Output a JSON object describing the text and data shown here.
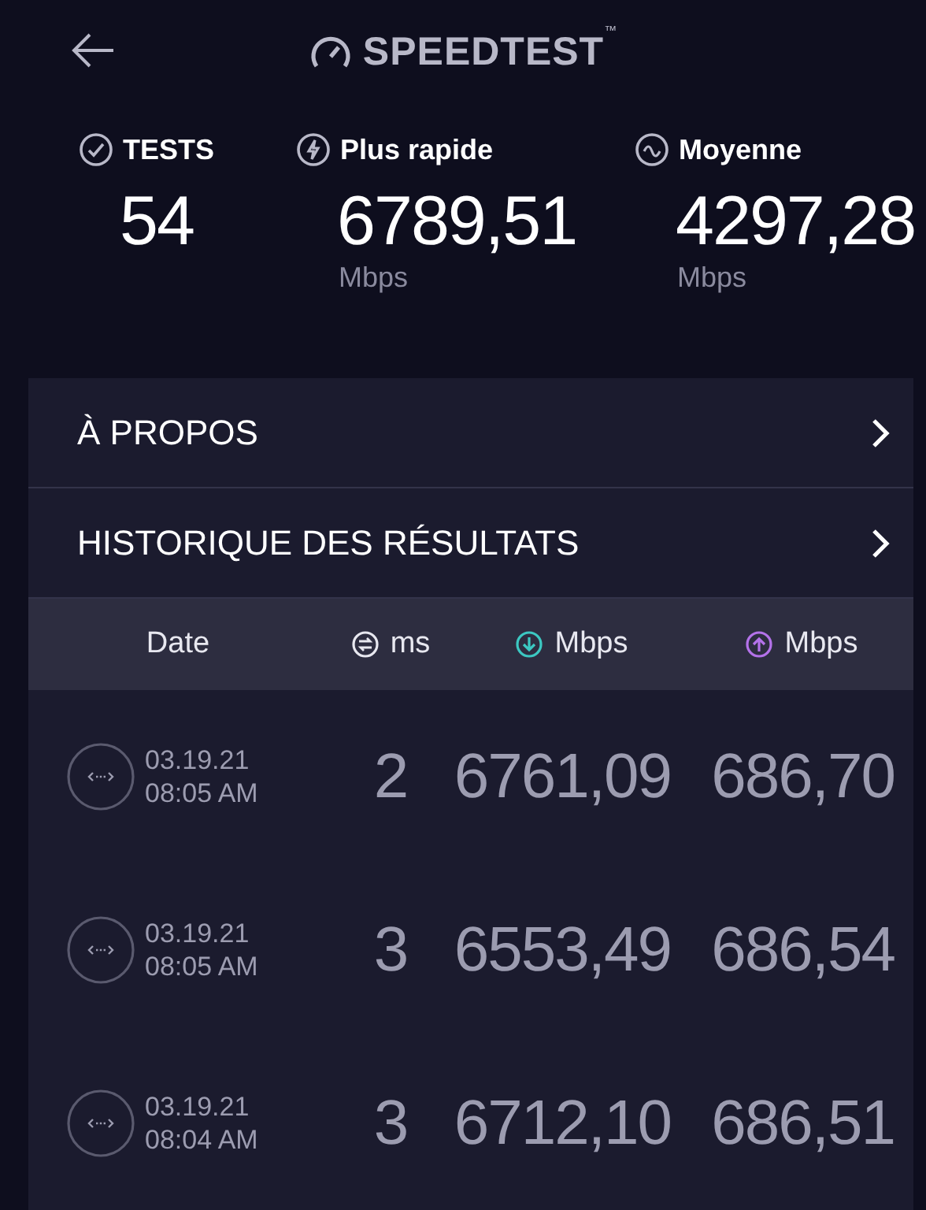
{
  "header": {
    "logo": "SPEEDTEST",
    "trademark": "™"
  },
  "stats": [
    {
      "kind": "tests",
      "label": "TESTS",
      "value": "54"
    },
    {
      "kind": "fastest",
      "label": "Plus rapide",
      "value": "6789,51",
      "unit": "Mbps"
    },
    {
      "kind": "average",
      "label": "Moyenne",
      "value": "4297,28",
      "unit": "Mbps"
    }
  ],
  "menu": [
    {
      "label": "À PROPOS"
    },
    {
      "label": "HISTORIQUE DES RÉSULTATS"
    }
  ],
  "table": {
    "columns": [
      {
        "kind": "date",
        "label": "Date"
      },
      {
        "kind": "ping",
        "label": "ms"
      },
      {
        "kind": "download",
        "label": "Mbps"
      },
      {
        "kind": "upload",
        "label": "Mbps"
      }
    ],
    "rows": [
      {
        "date": "03.19.21",
        "time": "08:05 AM",
        "ping": "2",
        "download": "6761,09",
        "upload": "686,70"
      },
      {
        "date": "03.19.21",
        "time": "08:05 AM",
        "ping": "3",
        "download": "6553,49",
        "upload": "686,54"
      },
      {
        "date": "03.19.21",
        "time": "08:04 AM",
        "ping": "3",
        "download": "6712,10",
        "upload": "686,51"
      }
    ]
  }
}
